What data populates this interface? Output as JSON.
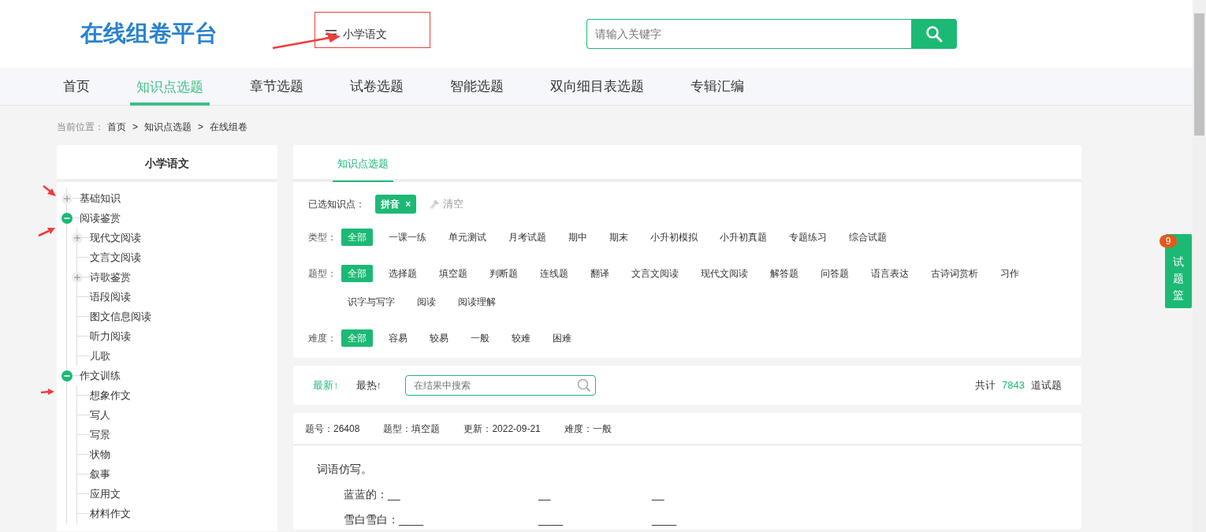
{
  "logo": "在线组卷平台",
  "subject_menu": {
    "label": "小学语文"
  },
  "search": {
    "placeholder": "请输入关键字"
  },
  "nav": [
    {
      "label": "首页",
      "selected": false
    },
    {
      "label": "知识点选题",
      "selected": true
    },
    {
      "label": "章节选题",
      "selected": false
    },
    {
      "label": "试卷选题",
      "selected": false
    },
    {
      "label": "智能选题",
      "selected": false
    },
    {
      "label": "双向细目表选题",
      "selected": false
    },
    {
      "label": "专辑汇编",
      "selected": false
    }
  ],
  "breadcrumb": {
    "label": "当前位置：",
    "separator": ">",
    "items": [
      "首页",
      "知识点选题",
      "在线组卷"
    ]
  },
  "sidebar": {
    "title": "小学语文",
    "tree": [
      {
        "label": "基础知识",
        "kind": "folder",
        "expanded": false
      },
      {
        "label": "阅读鉴赏",
        "kind": "folder",
        "expanded": true,
        "children": [
          {
            "label": "现代文阅读",
            "kind": "folder",
            "expanded": false
          },
          {
            "label": "文言文阅读",
            "kind": "leaf"
          },
          {
            "label": "诗歌鉴赏",
            "kind": "folder",
            "expanded": false
          },
          {
            "label": "语段阅读",
            "kind": "leaf"
          },
          {
            "label": "图文信息阅读",
            "kind": "leaf"
          },
          {
            "label": "听力阅读",
            "kind": "leaf"
          },
          {
            "label": "儿歌",
            "kind": "leaf"
          }
        ]
      },
      {
        "label": "作文训练",
        "kind": "folder",
        "expanded": true,
        "children": [
          {
            "label": "想象作文",
            "kind": "leaf"
          },
          {
            "label": "写人",
            "kind": "leaf"
          },
          {
            "label": "写景",
            "kind": "leaf"
          },
          {
            "label": "状物",
            "kind": "leaf"
          },
          {
            "label": "叙事",
            "kind": "leaf"
          },
          {
            "label": "应用文",
            "kind": "leaf"
          },
          {
            "label": "材料作文",
            "kind": "leaf"
          }
        ]
      }
    ]
  },
  "panel_tabs": [
    {
      "label": "知识点选题",
      "selected": true
    }
  ],
  "selected_points": {
    "label": "已选知识点：",
    "tags": [
      {
        "label": "拼音",
        "remove": "×"
      }
    ],
    "clear": "清空"
  },
  "filters": [
    {
      "label": "类型：",
      "options": [
        {
          "label": "全部",
          "selected": true
        },
        {
          "label": "一课一练",
          "selected": false
        },
        {
          "label": "单元测试",
          "selected": false
        },
        {
          "label": "月考试题",
          "selected": false
        },
        {
          "label": "期中",
          "selected": false
        },
        {
          "label": "期末",
          "selected": false
        },
        {
          "label": "小升初模拟",
          "selected": false
        },
        {
          "label": "小升初真题",
          "selected": false
        },
        {
          "label": "专题练习",
          "selected": false
        },
        {
          "label": "综合试题",
          "selected": false
        }
      ]
    },
    {
      "label": "题型：",
      "options": [
        {
          "label": "全部",
          "selected": true
        },
        {
          "label": "选择题",
          "selected": false
        },
        {
          "label": "填空题",
          "selected": false
        },
        {
          "label": "判断题",
          "selected": false
        },
        {
          "label": "连线题",
          "selected": false
        },
        {
          "label": "翻译",
          "selected": false
        },
        {
          "label": "文言文阅读",
          "selected": false
        },
        {
          "label": "现代文阅读",
          "selected": false
        },
        {
          "label": "解答题",
          "selected": false
        },
        {
          "label": "问答题",
          "selected": false
        },
        {
          "label": "语言表达",
          "selected": false
        },
        {
          "label": "古诗词赏析",
          "selected": false
        },
        {
          "label": "习作",
          "selected": false
        },
        {
          "label": "识字与写字",
          "selected": false
        },
        {
          "label": "阅读",
          "selected": false
        },
        {
          "label": "阅读理解",
          "selected": false
        }
      ]
    },
    {
      "label": "难度：",
      "options": [
        {
          "label": "全部",
          "selected": true
        },
        {
          "label": "容易",
          "selected": false
        },
        {
          "label": "较易",
          "selected": false
        },
        {
          "label": "一般",
          "selected": false
        },
        {
          "label": "较难",
          "selected": false
        },
        {
          "label": "困难",
          "selected": false
        }
      ]
    }
  ],
  "sort": [
    {
      "label": "最新↑",
      "selected": true
    },
    {
      "label": "最热↑",
      "selected": false
    }
  ],
  "result_search": {
    "placeholder": "在结果中搜索"
  },
  "total": {
    "prefix": "共计",
    "count": "7843",
    "suffix": "道试题"
  },
  "question": {
    "meta": [
      "题号：26408",
      "题型：填空题",
      "更新：2022-09-21",
      "难度：一般"
    ],
    "stem": "词语仿写。",
    "lines": [
      [
        "蓝蓝的：__",
        "__",
        "__"
      ],
      [
        "雪白雪白：____",
        "____",
        "____"
      ]
    ]
  },
  "basket": {
    "label": "试题篮",
    "count": "9"
  }
}
